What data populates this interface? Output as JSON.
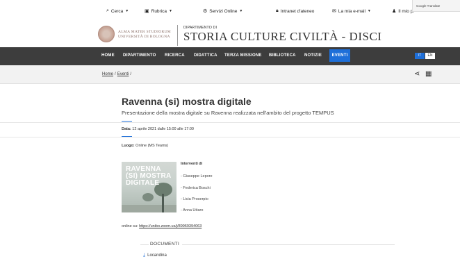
{
  "utility_bar": {
    "items": [
      {
        "icon": "search-icon",
        "glyph": "🔍",
        "label": "Cerca",
        "caret": true
      },
      {
        "icon": "address-book-icon",
        "glyph": "▣",
        "label": "Rubrica",
        "caret": true
      },
      {
        "icon": "gears-icon",
        "glyph": "⚙",
        "label": "Servizi Online",
        "caret": true
      },
      {
        "icon": "lock-icon",
        "glyph": "🔒",
        "label": "Intranet d'ateneo",
        "caret": false
      },
      {
        "icon": "envelope-icon",
        "glyph": "✉",
        "label": "La mia e-mail",
        "caret": true
      },
      {
        "icon": "user-icon",
        "glyph": "👤",
        "label": "Il mio pr",
        "caret": false
      }
    ],
    "google_translate": "Google Translate"
  },
  "header": {
    "logo_line1": "ALMA MATER STUDIORUM",
    "logo_line2": "UNIVERSITÀ DI BOLOGNA",
    "dept_prefix": "DIPARTIMENTO DI",
    "dept_name": "STORIA CULTURE CIVILTÀ - DISCI"
  },
  "nav": {
    "items": [
      "HOME",
      "DIPARTIMENTO",
      "RICERCA",
      "DIDATTICA",
      "TERZA MISSIONE",
      "BIBLIOTECA",
      "NOTIZIE",
      "EVENTI"
    ],
    "active": "EVENTI",
    "lang_it": "IT",
    "lang_en": "EN"
  },
  "breadcrumb": {
    "home": "Home",
    "sep": "/",
    "current": "Eventi",
    "trail_sep": "/"
  },
  "event": {
    "title": "Ravenna (si) mostra digitale",
    "subtitle": "Presentazione della mostra digitale su Ravenna realizzata nell'ambito del progetto TEMPUS",
    "data_label": "Data:",
    "data_value": "12 aprile 2021 dalle 15:00 alle 17:00",
    "luogo_label": "Luogo:",
    "luogo_value": "Online (MS Teams)",
    "image_text": [
      "RAVENNA",
      "(SI) MOSTRA",
      "DIGITALE"
    ],
    "interventi_title": "Interventi di",
    "speakers": [
      "Giuseppe Lepore",
      "Federica Boschi",
      "Licia Proserpio",
      "Anna Uttaro"
    ],
    "online_prefix": "online su:",
    "online_link": "https://unibo.zoom.us/j/89969394063"
  },
  "documents": {
    "title": "DOCUMENTI",
    "items": [
      {
        "label": "Locandina",
        "icon": "download-icon"
      }
    ]
  },
  "colors": {
    "accent": "#1e6fd9",
    "nav_bg": "#3d3d3d",
    "crumb_bg": "#f2f2f2"
  }
}
